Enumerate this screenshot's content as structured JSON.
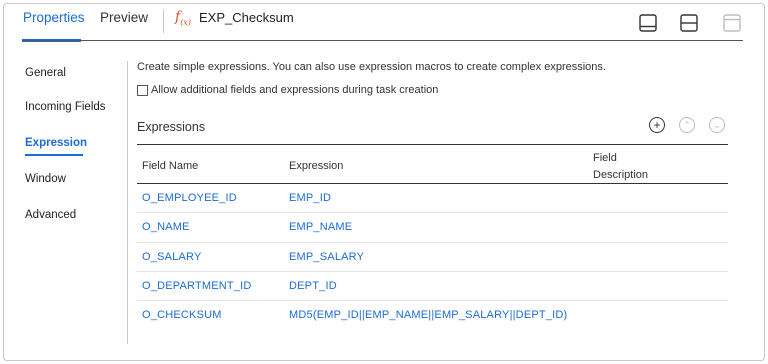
{
  "header": {
    "tabs": [
      {
        "label": "Properties",
        "active": true
      },
      {
        "label": "Preview",
        "active": false
      }
    ],
    "object_icon": "fx-expression-icon",
    "object_title": "EXP_Checksum",
    "layout_buttons": [
      "layout-bottom-panel-icon",
      "layout-split-icon",
      "layout-top-panel-icon"
    ]
  },
  "nav": {
    "items": [
      {
        "label": "General",
        "active": false
      },
      {
        "label": "Incoming Fields",
        "active": false
      },
      {
        "label": "Expression",
        "active": true
      },
      {
        "label": "Window",
        "active": false
      },
      {
        "label": "Advanced",
        "active": false
      }
    ]
  },
  "content": {
    "description": "Create simple expressions. You can also use expression macros to create complex expressions.",
    "allow_checkbox": {
      "label": "Allow additional fields and expressions during task creation",
      "checked": false
    },
    "section_title": "Expressions",
    "table": {
      "columns": [
        "Field Name",
        "Expression",
        "Field",
        "Description"
      ],
      "rows": [
        {
          "field": "O_EMPLOYEE_ID",
          "expression": "EMP_ID",
          "description": ""
        },
        {
          "field": "O_NAME",
          "expression": "EMP_NAME",
          "description": ""
        },
        {
          "field": "O_SALARY",
          "expression": "EMP_SALARY",
          "description": ""
        },
        {
          "field": "O_DEPARTMENT_ID",
          "expression": "DEPT_ID",
          "description": ""
        },
        {
          "field": "O_CHECKSUM",
          "expression": "MD5(EMP_ID||EMP_NAME||EMP_SALARY||DEPT_ID)",
          "description": ""
        }
      ]
    }
  },
  "colors": {
    "accent": "#1c6bd6",
    "fx_icon": "#d9531e",
    "text": "#333333",
    "divider": "#c8c8c8"
  }
}
